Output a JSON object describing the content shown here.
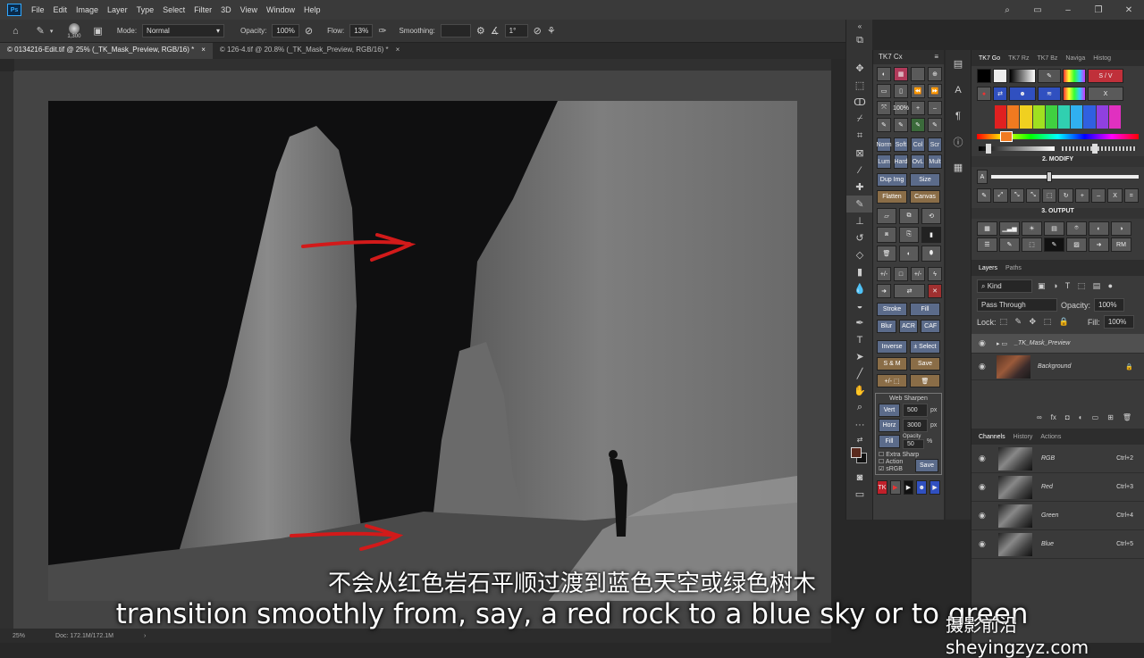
{
  "menu": {
    "app_icon": "Ps",
    "items": [
      "File",
      "Edit",
      "Image",
      "Layer",
      "Type",
      "Select",
      "Filter",
      "3D",
      "View",
      "Window",
      "Help"
    ]
  },
  "options": {
    "brush_size": "1,300",
    "mode_label": "Mode:",
    "mode_value": "Normal",
    "opacity_label": "Opacity:",
    "opacity_value": "100%",
    "flow_label": "Flow:",
    "flow_value": "13%",
    "smoothing_label": "Smoothing:",
    "angle_value": "1°"
  },
  "tabs": [
    {
      "label": "© 0134216-Edit.tif @ 25% (_TK_Mask_Preview, RGB/16) *",
      "close": "×"
    },
    {
      "label": "© 126-4.tif @ 20.8% (_TK_Mask_Preview, RGB/16) *",
      "close": "×"
    }
  ],
  "status": {
    "zoom": "25%",
    "doc": "Doc: 172.1M/172.1M",
    "arrow": "›"
  },
  "tk7cx": {
    "title": "TK7 Cx",
    "row_mode": [
      "Norm",
      "Soft",
      "Col",
      "Scr"
    ],
    "row_mode2": [
      "Lum",
      "Hard",
      "OvL",
      "Mult"
    ],
    "dup": "Dup Img",
    "size": "Size",
    "flatten": "Flatten",
    "canvas": "Canvas",
    "stroke": "Stroke",
    "fill": "Fill",
    "blur": "Blur",
    "acr": "ACR",
    "caf": "CAF",
    "inverse": "Inverse",
    "pm_select": "± Select",
    "sm": "S & M",
    "save": "Save",
    "web_sharpen": "Web Sharpen",
    "vert": "Vert",
    "vert_val": "500",
    "horz": "Horz",
    "horz_val": "3000",
    "px": "px",
    "fill2": "Fill",
    "opacity_lbl": "Opacity",
    "opacity_val": "50",
    "pct": "%",
    "extra_sharp": "Extra Sharp",
    "action": "Action",
    "srgb": "sRGB",
    "save2": "Save",
    "tk": "TK"
  },
  "right": {
    "tabs": [
      "TK7 Go",
      "TK7 Rz",
      "TK7 Bz",
      "Naviga",
      "Histog"
    ],
    "sv": "S / V",
    "x": "X",
    "modify": "2. MODIFY",
    "modify_a": "A",
    "output": "3. OUTPUT",
    "rm": "RM",
    "layers_tabs": [
      "Layers",
      "Paths"
    ],
    "kind": "Kind",
    "blend": "Pass Through",
    "opacity_label": "Opacity:",
    "opacity": "100%",
    "lock_label": "Lock:",
    "fill_label": "Fill:",
    "fill": "100%",
    "layers": [
      {
        "name": "_TK_Mask_Preview",
        "type": "group"
      },
      {
        "name": "Background",
        "type": "image"
      }
    ],
    "channel_tabs": [
      "Channels",
      "History",
      "Actions"
    ],
    "channels": [
      {
        "name": "RGB",
        "shortcut": "Ctrl+2"
      },
      {
        "name": "Red",
        "shortcut": "Ctrl+3"
      },
      {
        "name": "Green",
        "shortcut": "Ctrl+4"
      },
      {
        "name": "Blue",
        "shortcut": "Ctrl+5"
      }
    ]
  },
  "subtitle_cn": "不会从红色岩石平顺过渡到蓝色天空或绿色树木",
  "subtitle_en": "transition smoothly from, say, a red rock to a blue sky or to green",
  "watermark": "摄影前沿 sheyingzyz.com",
  "colors": {
    "accent_red": "#d21a1a",
    "panel_bg": "#3a3a3a",
    "tk_blue": "#5b6b8a",
    "tk_orange": "#8a6d47"
  }
}
